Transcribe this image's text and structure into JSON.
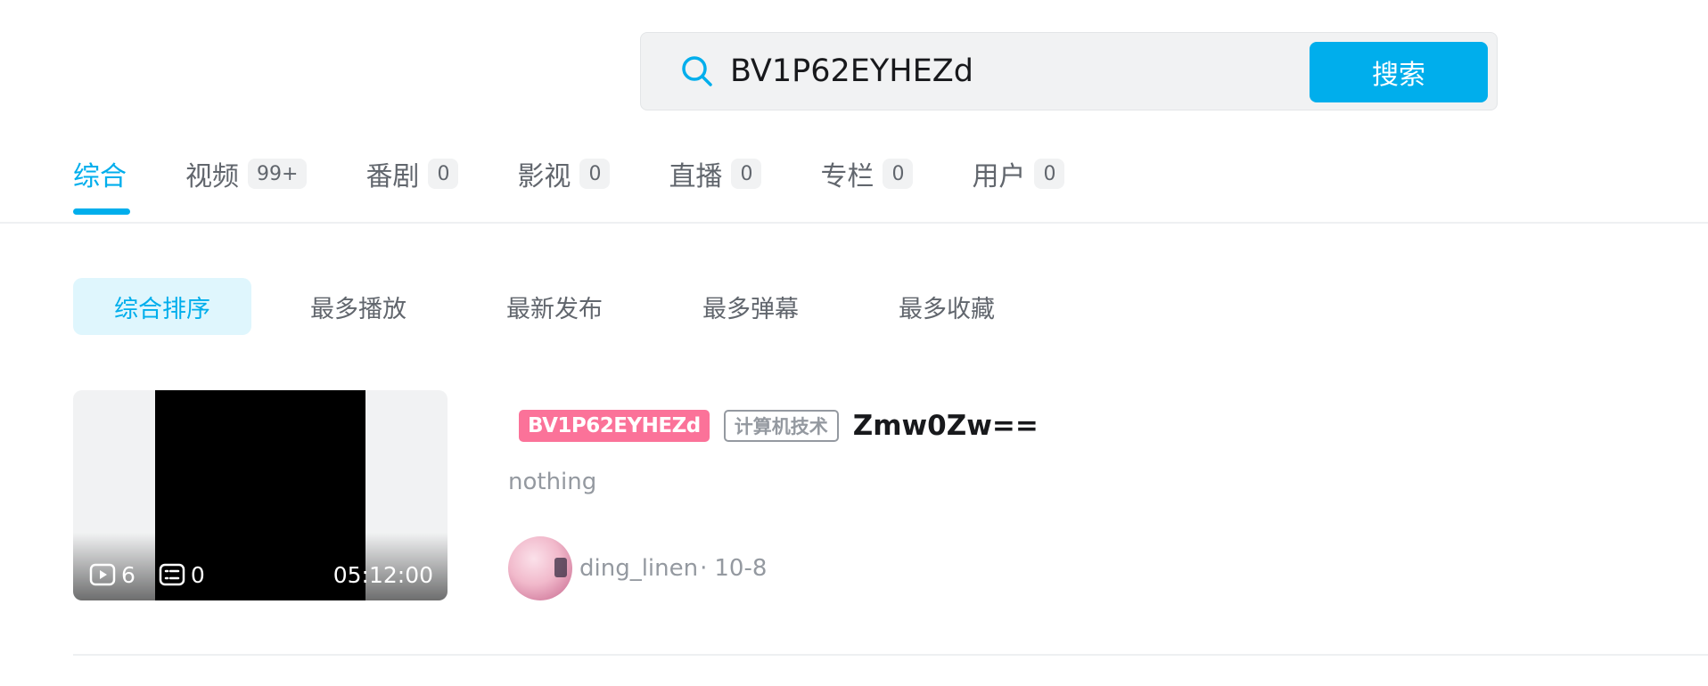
{
  "search": {
    "value": "BV1P62EYHEZd",
    "button_label": "搜索"
  },
  "type_tabs": [
    {
      "label": "综合",
      "count": ""
    },
    {
      "label": "视频",
      "count": "99+"
    },
    {
      "label": "番剧",
      "count": "0"
    },
    {
      "label": "影视",
      "count": "0"
    },
    {
      "label": "直播",
      "count": "0"
    },
    {
      "label": "专栏",
      "count": "0"
    },
    {
      "label": "用户",
      "count": "0"
    }
  ],
  "sort_options": [
    "综合排序",
    "最多播放",
    "最新发布",
    "最多弹幕",
    "最多收藏"
  ],
  "video": {
    "views": "6",
    "danmaku": "0",
    "duration": "05:12:00",
    "bv_tag": "BV1P62EYHEZd",
    "category": "计算机技术",
    "title": "Zmw0Zw==",
    "description": "nothing",
    "author": "ding_linen",
    "separator": "·",
    "date": "10-8"
  },
  "colors": {
    "accent": "#00aeec",
    "pink_tag": "#fb7299"
  },
  "icons": {
    "search": "search-icon",
    "views": "play-icon",
    "danmaku": "danmaku-icon"
  }
}
